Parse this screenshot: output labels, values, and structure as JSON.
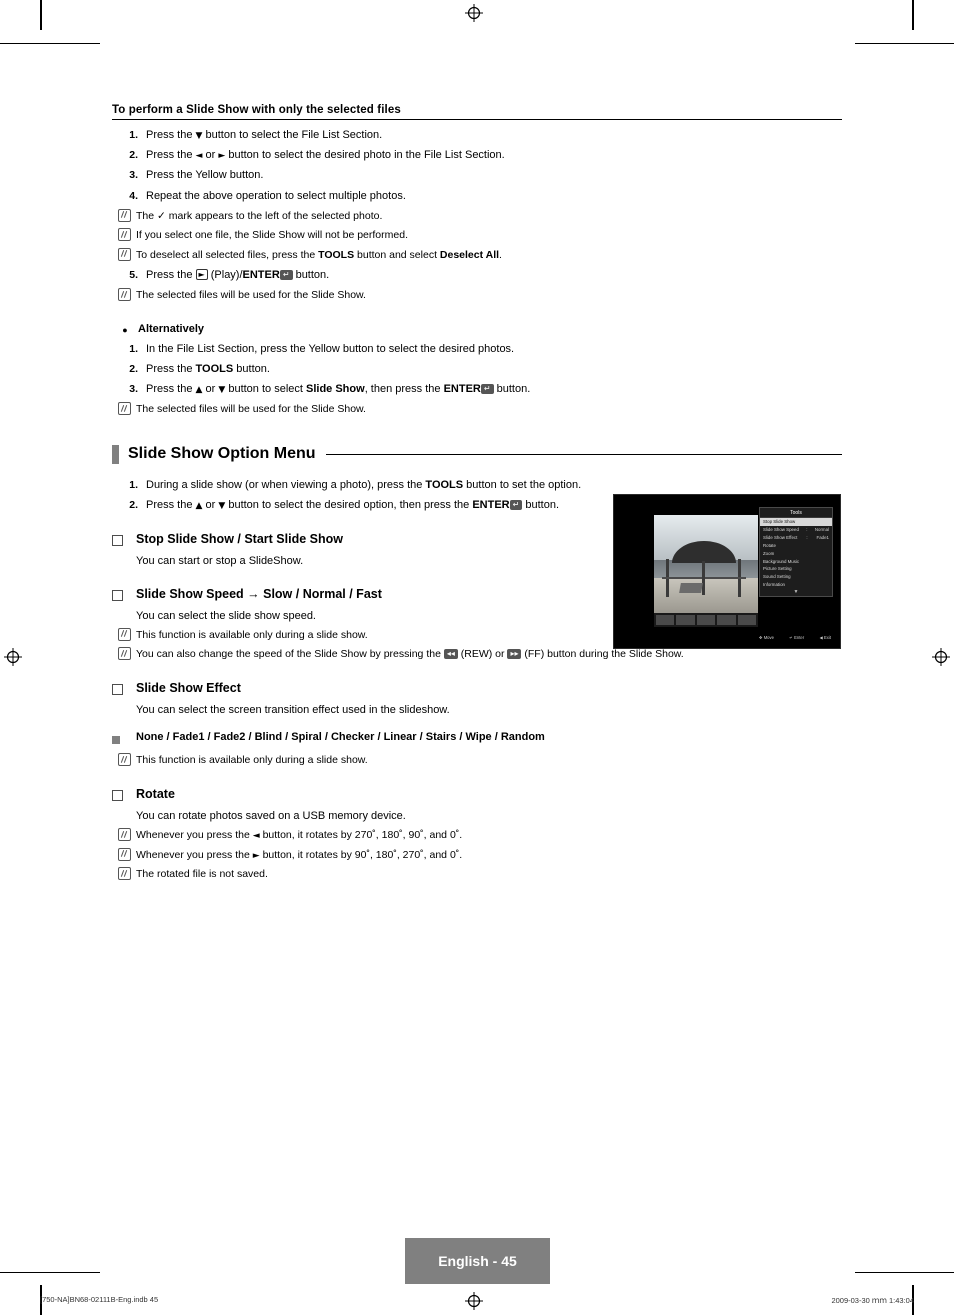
{
  "page": {
    "number_label": "English - 45",
    "footer_left": "[750-NA]BN68-02111B-Eng.indb   45",
    "footer_right": "2009-03-30   ｍｍ 1:43:04"
  },
  "section_a": {
    "heading": "To perform a Slide Show with only the selected files",
    "steps": [
      {
        "n": "1.",
        "text_html": "Press the ▼ button to select the File List Section."
      },
      {
        "n": "2.",
        "text_html": "Press the ◄ or ► button to select the desired photo in the File List Section."
      },
      {
        "n": "3.",
        "text_html": "Press the Yellow button."
      },
      {
        "n": "4.",
        "text_html": "Repeat the above operation to select multiple photos."
      }
    ],
    "notes_after_4": [
      "The ✓ mark appears to the left of the selected photo.",
      "If you select one file, the Slide Show will not be performed.",
      "To deselect all selected files, press the TOOLS button and select Deselect All."
    ],
    "step5": {
      "n": "5.",
      "text_html": "Press the ► (Play)/ENTER button."
    },
    "notes_after_5": [
      "The selected files will be used for the Slide Show."
    ]
  },
  "section_alt": {
    "bullet_label": "Alternatively",
    "steps": [
      {
        "n": "1.",
        "text_html": "In the File List Section, press the Yellow button to select the desired photos."
      },
      {
        "n": "2.",
        "text_html": "Press the TOOLS button."
      },
      {
        "n": "3.",
        "text_html": "Press the ▲ or ▼ button to select Slide Show, then press the ENTER button."
      }
    ],
    "notes": [
      "The selected files will be used for the Slide Show."
    ]
  },
  "slide_show_option_menu": {
    "title": "Slide Show Option Menu",
    "steps": [
      {
        "n": "1.",
        "text_html": "During a slide show (or when viewing a photo), press the TOOLS button to set the option."
      },
      {
        "n": "2.",
        "text_html": "Press the ▲ or ▼ button to select the desired option, then press the ENTER button."
      }
    ],
    "options": [
      {
        "title": "Stop Slide Show / Start Slide Show",
        "body": "You can start or stop a SlideShow.",
        "notes": []
      },
      {
        "title": "Slide Show Speed → Slow / Normal / Fast",
        "body": "You can select the slide show speed.",
        "notes": [
          "This function is available only during a slide show.",
          "You can also change the speed of the Slide Show by pressing the ◄◄ (REW) or ►► (FF) button during the Slide Show."
        ]
      },
      {
        "title": "Slide Show Effect",
        "body": "You can select the screen transition effect used in the slideshow.",
        "effects_label": "None / Fade1 / Fade2 / Blind / Spiral / Checker / Linear / Stairs / Wipe / Random",
        "notes": [
          "This function is available only during a slide show."
        ]
      },
      {
        "title": "Rotate",
        "body": "You can rotate photos saved on a USB memory device.",
        "notes": [
          "Whenever you press the ◄ button, it rotates by 270˚, 180˚, 90˚, and 0˚.",
          "Whenever you press the ► button, it rotates by 90˚, 180˚, 270˚, and 0˚.",
          "The rotated file is not saved."
        ]
      }
    ]
  },
  "tv_screenshot": {
    "menu_title": "Tools",
    "rows": [
      {
        "label": "Stop Slide Show",
        "value": "",
        "selected": true
      },
      {
        "label": "Slide Show Speed",
        "value": "Normal",
        "sep": ":",
        "selected": false
      },
      {
        "label": "Slide Show Effect",
        "value": "Fade1",
        "sep": ":",
        "selected": false
      },
      {
        "label": "Rotate",
        "value": "",
        "selected": false
      },
      {
        "label": "Zoom",
        "value": "",
        "selected": false
      },
      {
        "label": "Background Music",
        "value": "",
        "selected": false
      },
      {
        "label": "Picture Setting",
        "value": "",
        "selected": false
      },
      {
        "label": "Sound Setting",
        "value": "",
        "selected": false
      },
      {
        "label": "Information",
        "value": "",
        "selected": false
      }
    ],
    "scroll_glyph": "▼",
    "footer": [
      {
        "icon": "✥",
        "label": "Move"
      },
      {
        "icon": "↵",
        "label": "Enter"
      },
      {
        "icon": "◀",
        "label": "Exit"
      }
    ]
  }
}
